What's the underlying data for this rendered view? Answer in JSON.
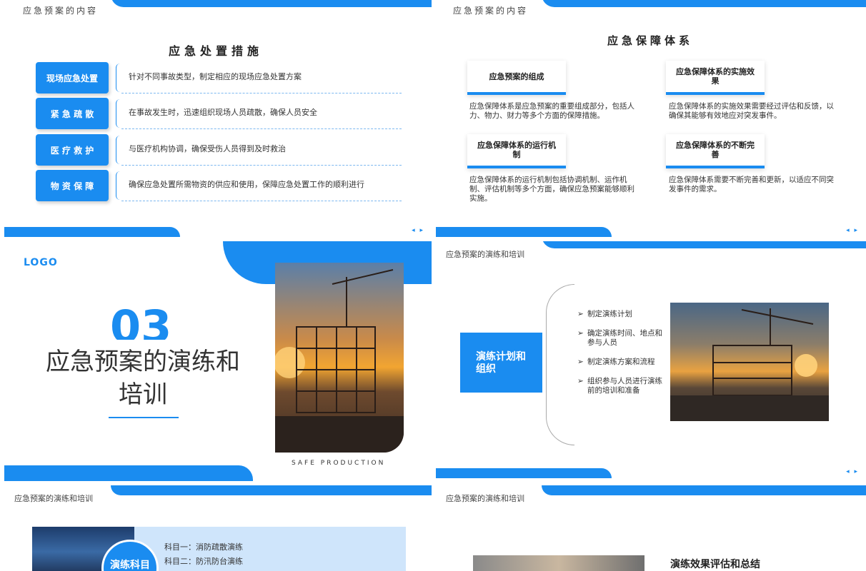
{
  "slide1": {
    "header": "应急预案的内容",
    "title": "应急处置措施",
    "rows": [
      {
        "tag": "现场应急处置",
        "desc": "针对不同事故类型，制定相应的现场应急处置方案"
      },
      {
        "tag": "紧 急 疏 散",
        "desc": "在事故发生时，迅速组织现场人员疏散，确保人员安全"
      },
      {
        "tag": "医 疗 救 护",
        "desc": "与医疗机构协调，确保受伤人员得到及时救治"
      },
      {
        "tag": "物 资 保 障",
        "desc": "确保应急处置所需物资的供应和使用，保障应急处置工作的顺利进行"
      }
    ],
    "nav": "◂ ▸"
  },
  "slide2": {
    "header": "应急预案的内容",
    "title": "应急保障体系",
    "cards": [
      {
        "label": "应急预案的组成",
        "text": "应急保障体系是应急预案的重要组成部分，包括人力、物力、财力等多个方面的保障措施。"
      },
      {
        "label": "应急保障体系的实施效果",
        "text": "应急保障体系的实施效果需要经过评估和反馈，以确保其能够有效地应对突发事件。"
      },
      {
        "label": "应急保障体系的运行机制",
        "text": "应急保障体系的运行机制包括协调机制、运作机制、评估机制等多个方面，确保应急预案能够顺利实施。"
      },
      {
        "label": "应急保障体系的不断完善",
        "text": "应急保障体系需要不断完善和更新，以适应不同突发事件的需求。"
      }
    ],
    "nav": "◂ ▸"
  },
  "slide3": {
    "logo": "LOGO",
    "number": "03",
    "title_line1": "应急预案的演练和",
    "title_line2": "培训",
    "caption": "SAFE PRODUCTION"
  },
  "slide4": {
    "header": "应急预案的演练和培训",
    "box_line1": "演练计划和",
    "box_line2": "组织",
    "items": [
      "制定演练计划",
      "确定演练时间、地点和参与人员",
      "制定演练方案和流程",
      "组织参与人员进行演练前的培训和准备"
    ],
    "nav": "◂ ▸"
  },
  "slide5": {
    "header": "应急预案的演练和培训",
    "circle_text": "演练科目",
    "subjects": [
      "科目一：消防疏散演练",
      "科目二：防汛防台演练"
    ]
  },
  "slide6": {
    "header": "应急预案的演练和培训",
    "eval_title": "演练效果评估和总结"
  },
  "colors": {
    "accent": "#1a8cf0",
    "light_accent": "#cfe5fb"
  }
}
